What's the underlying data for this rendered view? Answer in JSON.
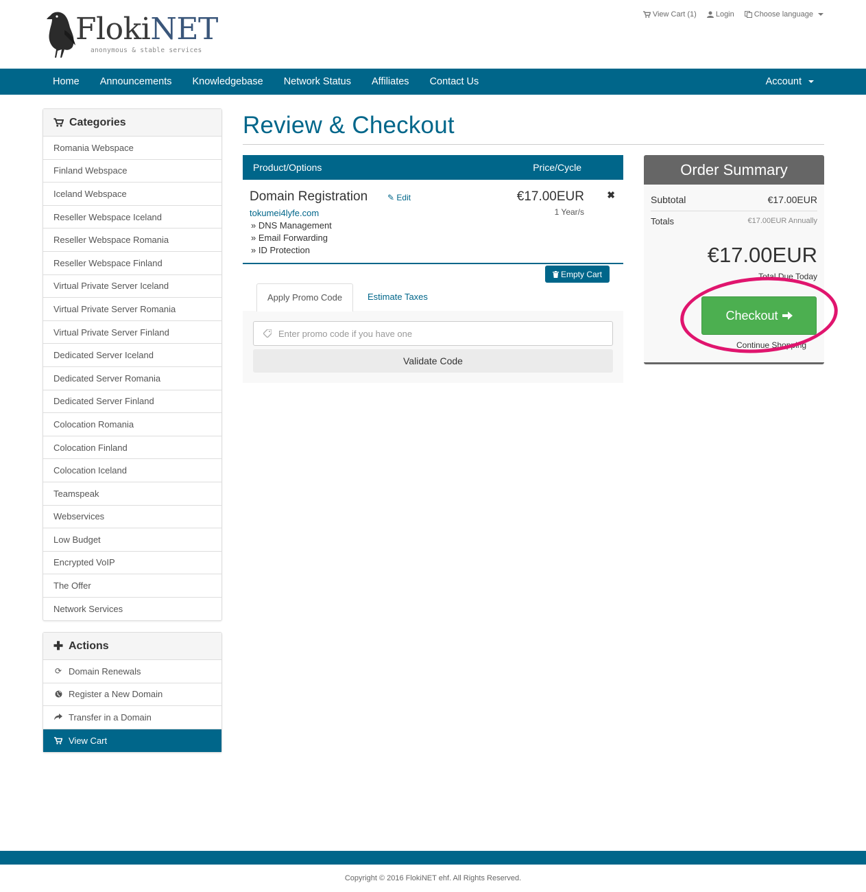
{
  "brand": {
    "name_part1": "Floki",
    "name_part2": "NET",
    "tagline": "anonymous & stable services"
  },
  "top_links": {
    "view_cart": "View Cart (1)",
    "login": "Login",
    "language": "Choose language"
  },
  "nav": {
    "items": [
      "Home",
      "Announcements",
      "Knowledgebase",
      "Network Status",
      "Affiliates",
      "Contact Us"
    ],
    "account": "Account"
  },
  "categories": {
    "title": "Categories",
    "items": [
      "Romania Webspace",
      "Finland Webspace",
      "Iceland Webspace",
      "Reseller Webspace Iceland",
      "Reseller Webspace Romania",
      "Reseller Webspace Finland",
      "Virtual Private Server Iceland",
      "Virtual Private Server Romania",
      "Virtual Private Server Finland",
      "Dedicated Server Iceland",
      "Dedicated Server Romania",
      "Dedicated Server Finland",
      "Colocation Romania",
      "Colocation Finland",
      "Colocation Iceland",
      "Teamspeak",
      "Webservices",
      "Low Budget",
      "Encrypted VoIP",
      "The Offer",
      "Network Services"
    ]
  },
  "actions": {
    "title": "Actions",
    "items": [
      {
        "label": "Domain Renewals",
        "icon": "refresh-icon"
      },
      {
        "label": "Register a New Domain",
        "icon": "globe-icon"
      },
      {
        "label": "Transfer in a Domain",
        "icon": "share-icon"
      },
      {
        "label": "View Cart",
        "icon": "cart-icon"
      }
    ]
  },
  "page": {
    "title": "Review & Checkout"
  },
  "cart": {
    "col_product": "Product/Options",
    "col_price": "Price/Cycle",
    "item": {
      "name": "Domain Registration",
      "edit": "Edit",
      "domain": "tokumei4lyfe.com",
      "options": [
        "» DNS Management",
        "» Email Forwarding",
        "» ID Protection"
      ],
      "price": "€17.00EUR",
      "cycle": "1 Year/s",
      "remove": "✖"
    },
    "empty_cart": "Empty Cart"
  },
  "promo": {
    "tab_active": "Apply Promo Code",
    "tab_other": "Estimate Taxes",
    "placeholder": "Enter promo code if you have one",
    "validate": "Validate Code"
  },
  "summary": {
    "title": "Order Summary",
    "subtotal_label": "Subtotal",
    "subtotal_value": "€17.00EUR",
    "totals_label": "Totals",
    "totals_value": "€17.00EUR Annually",
    "total_due": "€17.00EUR",
    "total_due_label": "Total Due Today",
    "checkout": "Checkout",
    "continue": "Continue Shopping"
  },
  "footer": {
    "copyright": "Copyright © 2016 FlokiNET ehf. All Rights Reserved."
  },
  "colors": {
    "brand_blue": "#00668a",
    "checkout_green": "#4caf50",
    "highlight_pink": "#e0156e"
  }
}
